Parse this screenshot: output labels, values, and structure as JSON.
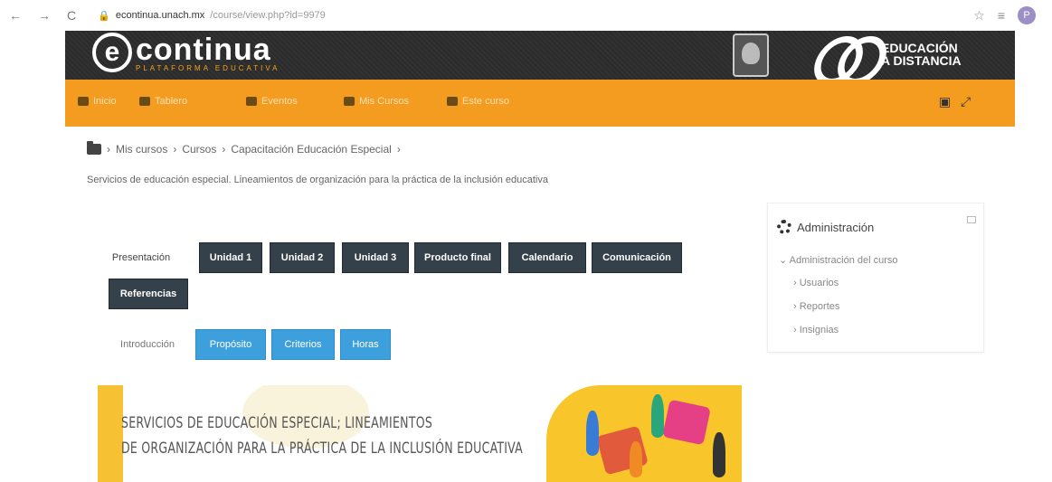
{
  "browser": {
    "url_host": "econtinua.unach.mx",
    "url_path": "/course/view.php?id=9979",
    "profile_initial": "P"
  },
  "header": {
    "logo_letter": "e",
    "logo_word": "continua",
    "logo_sub": "PLATAFORMA EDUCATIVA",
    "ead_line1": "EDUCACIÓN",
    "ead_line2": "A DISTANCIA"
  },
  "topnav": {
    "items": [
      {
        "label": "Inicio",
        "icon": "home-icon"
      },
      {
        "label": "Tablero",
        "icon": "dashboard-icon"
      },
      {
        "label": "Eventos",
        "icon": "calendar-icon"
      },
      {
        "label": "Mis Cursos",
        "icon": "briefcase-icon"
      },
      {
        "label": "Este curso",
        "icon": "sitemap-icon"
      }
    ]
  },
  "breadcrumb": {
    "items": [
      "Mis cursos",
      "Cursos",
      "Capacitación Educación Especial"
    ]
  },
  "course_title": "Servicios de educación especial. Lineamientos de organización para la práctica de la inclusión educativa",
  "tabs": {
    "row1": [
      "Presentación",
      "Unidad 1",
      "Unidad 2",
      "Unidad 3",
      "Producto final",
      "Calendario",
      "Comunicación",
      "Referencias"
    ],
    "row2": [
      "Introducción",
      "Propósito",
      "Criterios",
      "Horas"
    ]
  },
  "hero": {
    "line1": "SERVICIOS DE EDUCACIÓN ESPECIAL; LINEAMIENTOS",
    "line2": "DE ORGANIZACIÓN PARA LA PRÁCTICA DE LA INCLUSIÓN EDUCATIVA"
  },
  "admin": {
    "title": "Administración",
    "section": "Administración del curso",
    "items": [
      "Usuarios",
      "Reportes",
      "Insignias"
    ]
  }
}
